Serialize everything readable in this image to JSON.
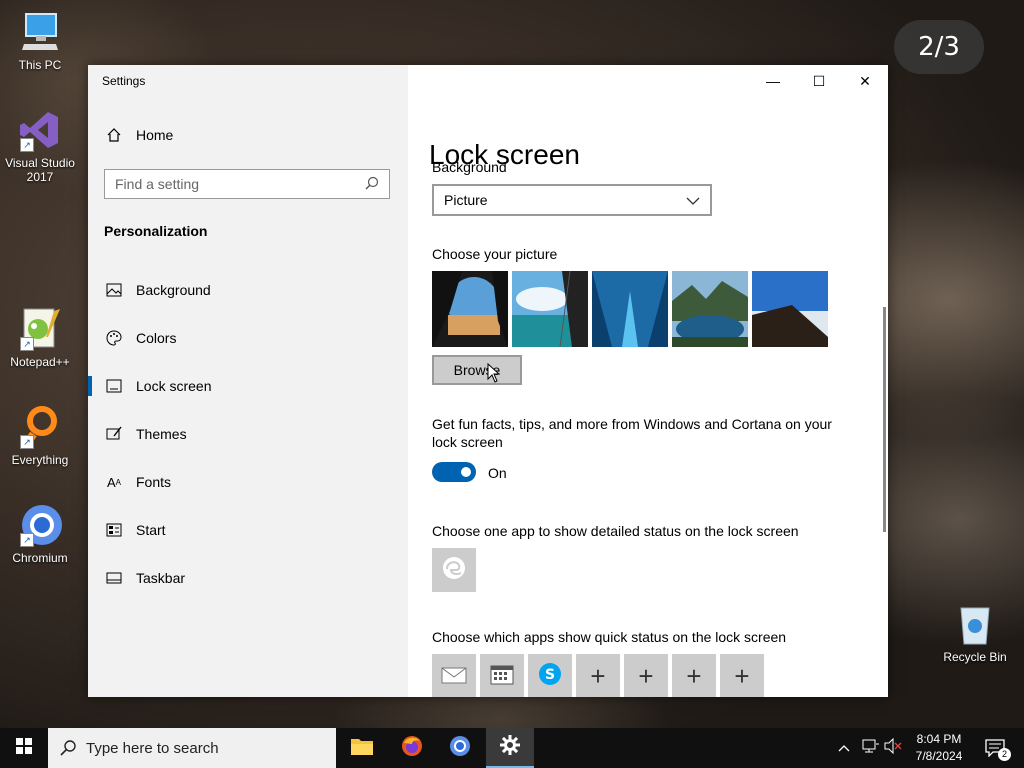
{
  "overlay": {
    "counter": "2/3"
  },
  "desktop": {
    "icons": [
      {
        "label": "This PC",
        "icon": "computer-icon"
      },
      {
        "label": "Visual Studio 2017",
        "icon": "visual-studio-icon"
      },
      {
        "label": "Notepad++",
        "icon": "notepadpp-icon"
      },
      {
        "label": "Everything",
        "icon": "everything-icon"
      },
      {
        "label": "Chromium",
        "icon": "chromium-icon"
      },
      {
        "label": "Recycle Bin",
        "icon": "recycle-bin-icon"
      }
    ]
  },
  "window": {
    "title": "Settings",
    "controls": {
      "minimize": "—",
      "maximize": "☐",
      "close": "✕"
    }
  },
  "sidebar": {
    "home": "Home",
    "search_placeholder": "Find a setting",
    "section": "Personalization",
    "items": [
      {
        "label": "Background",
        "icon": "background-icon"
      },
      {
        "label": "Colors",
        "icon": "palette-icon"
      },
      {
        "label": "Lock screen",
        "icon": "lock-screen-icon",
        "active": true
      },
      {
        "label": "Themes",
        "icon": "themes-icon"
      },
      {
        "label": "Fonts",
        "icon": "fonts-icon"
      },
      {
        "label": "Start",
        "icon": "start-icon"
      },
      {
        "label": "Taskbar",
        "icon": "taskbar-icon"
      }
    ]
  },
  "main": {
    "title": "Lock screen",
    "background_label": "Background",
    "background_value": "Picture",
    "choose_picture_label": "Choose your picture",
    "browse_label": "Browse",
    "tips_text": "Get fun facts, tips, and more from Windows and Cortana on your lock screen",
    "tips_toggle": {
      "state": "On",
      "on": true
    },
    "detailed_status_label": "Choose one app to show detailed status on the lock screen",
    "quick_status_label": "Choose which apps show quick status on the lock screen"
  },
  "taskbar": {
    "search_placeholder": "Type here to search",
    "time": "8:04 PM",
    "date": "7/8/2024",
    "notification_count": "2"
  },
  "colors": {
    "accent": "#0063b1",
    "sidebar_bg": "#f2f2f2",
    "taskbar_bg": "#101010"
  }
}
